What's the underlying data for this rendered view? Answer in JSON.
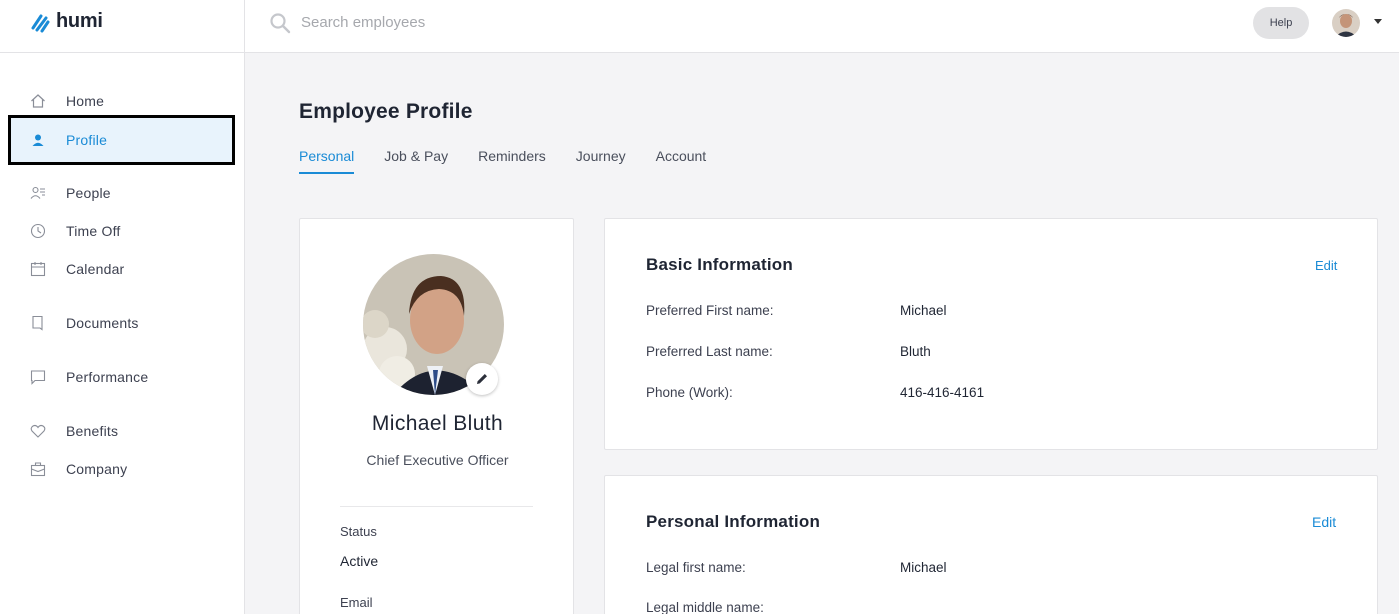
{
  "brand": {
    "name": "humi",
    "color": "#1a8bd6"
  },
  "search": {
    "placeholder": "Search employees",
    "value": ""
  },
  "header": {
    "help_label": "Help"
  },
  "sidebar": {
    "items": [
      {
        "label": "Home",
        "icon": "home-icon"
      },
      {
        "label": "Profile",
        "icon": "person-icon",
        "active": true
      },
      {
        "label": "People",
        "icon": "people-icon"
      },
      {
        "label": "Time Off",
        "icon": "clock-icon"
      },
      {
        "label": "Calendar",
        "icon": "calendar-icon"
      },
      {
        "label": "Documents",
        "icon": "document-icon"
      },
      {
        "label": "Performance",
        "icon": "chat-icon"
      },
      {
        "label": "Benefits",
        "icon": "heart-icon"
      },
      {
        "label": "Company",
        "icon": "briefcase-icon"
      }
    ]
  },
  "page": {
    "title": "Employee Profile",
    "tabs": [
      {
        "label": "Personal",
        "active": true
      },
      {
        "label": "Job & Pay"
      },
      {
        "label": "Reminders"
      },
      {
        "label": "Journey"
      },
      {
        "label": "Account"
      }
    ]
  },
  "profile": {
    "name": "Michael Bluth",
    "job_title": "Chief Executive Officer",
    "status_label": "Status",
    "status_value": "Active",
    "email_label": "Email"
  },
  "basic_info": {
    "heading": "Basic Information",
    "edit_label": "Edit",
    "rows": [
      {
        "label": "Preferred First name:",
        "value": "Michael"
      },
      {
        "label": "Preferred Last name:",
        "value": "Bluth"
      },
      {
        "label": "Phone (Work):",
        "value": "416-416-4161"
      }
    ]
  },
  "personal_info": {
    "heading": "Personal Information",
    "edit_label": "Edit",
    "rows": [
      {
        "label": "Legal first name:",
        "value": "Michael"
      },
      {
        "label": "Legal middle name:",
        "value": ""
      }
    ]
  },
  "colors": {
    "accent": "#1a8bd6",
    "active_nav_bg": "#e8f3fc"
  }
}
